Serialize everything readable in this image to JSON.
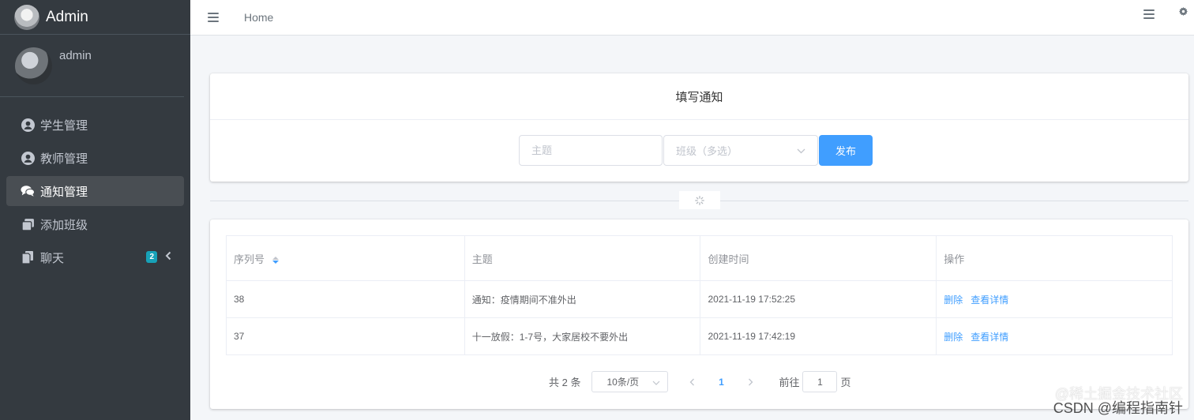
{
  "brand": {
    "title": "Admin"
  },
  "user": {
    "name": "admin"
  },
  "sidebar": {
    "items": [
      {
        "label": "学生管理",
        "icon": "user-circle-icon",
        "active": false
      },
      {
        "label": "教师管理",
        "icon": "user-circle-icon",
        "active": false
      },
      {
        "label": "通知管理",
        "icon": "comments-icon",
        "active": true
      },
      {
        "label": "添加班级",
        "icon": "clone-icon",
        "active": false
      },
      {
        "label": "聊天",
        "icon": "copy-icon",
        "active": false,
        "badge": "2"
      }
    ]
  },
  "topbar": {
    "home_label": "Home"
  },
  "form": {
    "title": "填写通知",
    "topic_placeholder": "主题",
    "class_placeholder": "班级（多选）",
    "publish_label": "发布"
  },
  "table": {
    "headers": [
      "序列号",
      "主题",
      "创建时间",
      "操作"
    ],
    "rows": [
      {
        "id": "38",
        "topic": "通知：疫情期间不准外出",
        "created": "2021-11-19 17:52:25",
        "delete": "删除",
        "detail": "查看详情"
      },
      {
        "id": "37",
        "topic": "十一放假：1-7号，大家居校不要外出",
        "created": "2021-11-19 17:42:19",
        "delete": "删除",
        "detail": "查看详情"
      }
    ]
  },
  "pagination": {
    "total_label": "共 2 条",
    "page_size_label": "10条/页",
    "current_page": "1",
    "jump_prefix": "前往",
    "jump_value": "1",
    "jump_suffix": "页"
  },
  "watermark": {
    "line1": "@稀土掘金技术社区",
    "line2": "CSDN @编程指南针"
  },
  "colors": {
    "sidebar_bg": "#343a40",
    "accent": "#409eff",
    "badge": "#17a2b8"
  }
}
